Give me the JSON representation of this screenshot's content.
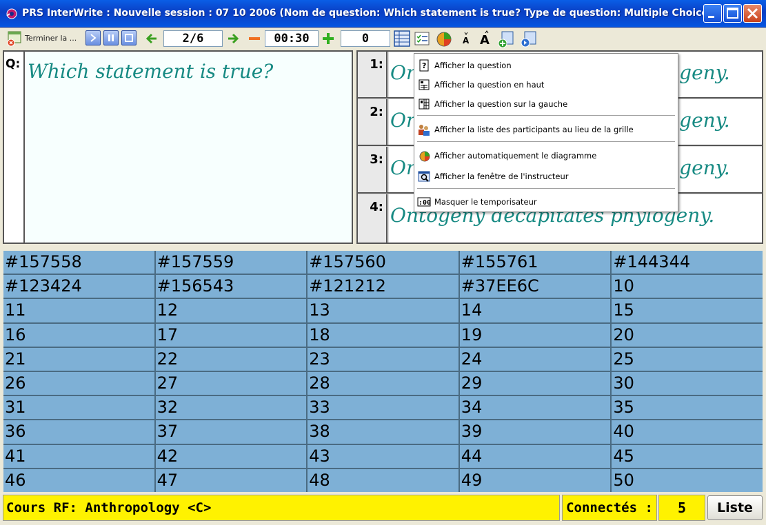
{
  "window": {
    "title": "PRS InterWrite : Nouvelle session : 07 10 2006 (Nom de question: Which statement is true?  Type de question: Multiple Choice)"
  },
  "toolbar": {
    "end_label": "Terminer la ...",
    "question_counter": "2/6",
    "timer": "00:30",
    "response_count": "0"
  },
  "question": {
    "label": "Q:",
    "text": "Which statement is true?"
  },
  "answers": [
    {
      "num": "1:",
      "text": "Ontogeny recapitulates phylogeny."
    },
    {
      "num": "2:",
      "text": "Ontogeny recapitulates phylogeny."
    },
    {
      "num": "3:",
      "text": "Ontogeny recapitulates phylogeny."
    },
    {
      "num": "4:",
      "text": "Ontogeny decapitates phylogeny."
    }
  ],
  "menu": {
    "items": [
      {
        "label": "Afficher la question",
        "icon": "question-icon"
      },
      {
        "label": "Afficher la question en haut",
        "icon": "layout-top-icon"
      },
      {
        "label": "Afficher la question sur la gauche",
        "icon": "layout-left-icon"
      },
      {
        "label": "Afficher la liste des participants au lieu de la grille",
        "icon": "participants-icon"
      },
      {
        "label": "Afficher automatiquement le diagramme",
        "icon": "pie-chart-icon"
      },
      {
        "label": "Afficher la fenêtre de l'instructeur",
        "icon": "instructor-window-icon"
      },
      {
        "label": "Masquer le temporisateur",
        "icon": "timer-icon"
      }
    ],
    "timer_icon_text": ":00"
  },
  "grid": {
    "cells": [
      "#157558",
      "#157559",
      "#157560",
      "#155761",
      "#144344",
      "#123424",
      "#156543",
      "#121212",
      "#37EE6C",
      "10",
      "11",
      "12",
      "13",
      "14",
      "15",
      "16",
      "17",
      "18",
      "19",
      "20",
      "21",
      "22",
      "23",
      "24",
      "25",
      "26",
      "27",
      "28",
      "29",
      "30",
      "31",
      "32",
      "33",
      "34",
      "35",
      "36",
      "37",
      "38",
      "39",
      "40",
      "41",
      "42",
      "43",
      "44",
      "45",
      "46",
      "47",
      "48",
      "49",
      "50"
    ]
  },
  "status": {
    "course": "Cours RF: Anthropology <C>",
    "connected_label": "Connectés :",
    "connected_count": "5",
    "list_button": "Liste"
  },
  "colors": {
    "title_bar": "#0a4ed8",
    "grid_cell": "#7eb0d6",
    "status_yellow": "#fff200",
    "answer_text": "#178a83"
  }
}
